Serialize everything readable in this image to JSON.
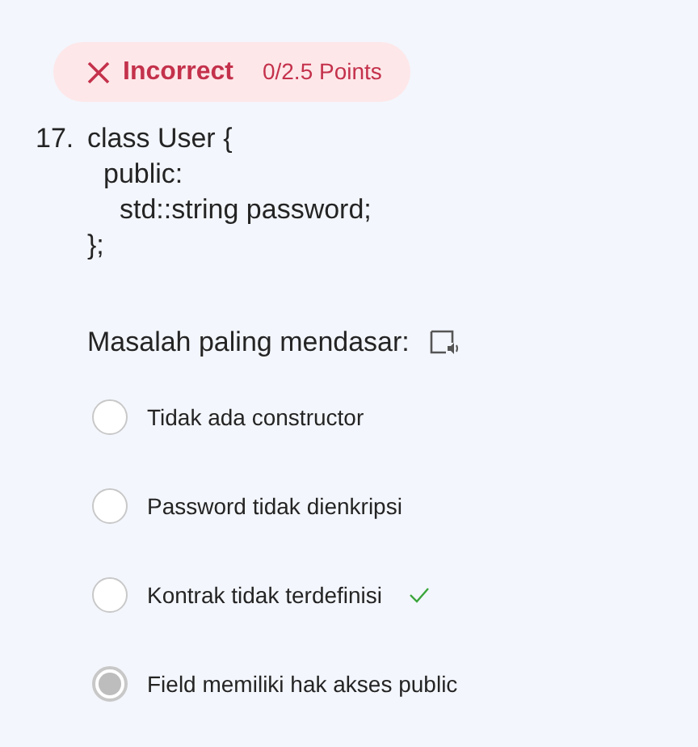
{
  "result": {
    "status": "Incorrect",
    "points": "0/2.5 Points"
  },
  "question": {
    "number": "17.",
    "code": [
      {
        "text": "class User {",
        "children": [
          {
            "text": "public:",
            "children": [
              {
                "text": "std::string password;"
              }
            ]
          }
        ]
      },
      {
        "text": "};"
      }
    ],
    "prompt": "Masalah paling mendasar:",
    "options": [
      {
        "label": "Tidak ada constructor",
        "selected": false,
        "correct": false
      },
      {
        "label": "Password tidak dienkripsi",
        "selected": false,
        "correct": false
      },
      {
        "label": "Kontrak tidak terdefinisi",
        "selected": false,
        "correct": true
      },
      {
        "label": "Field memiliki hak akses public",
        "selected": true,
        "correct": false
      }
    ]
  }
}
